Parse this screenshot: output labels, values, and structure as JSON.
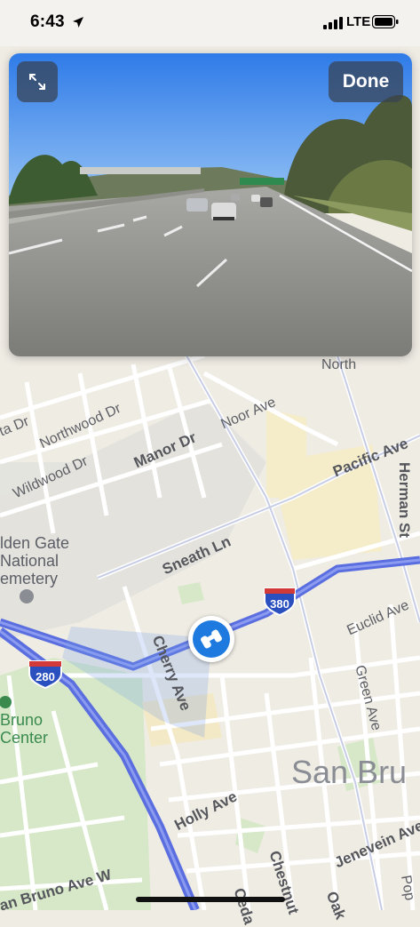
{
  "status_bar": {
    "time": "6:43",
    "carrier": "LTE"
  },
  "look_around": {
    "done_label": "Done"
  },
  "map": {
    "streets": {
      "north": "North",
      "northwood": "Northwood Dr",
      "wildwood": "Wildwood Dr",
      "manor": "Manor Dr",
      "noor": "Noor Ave",
      "pacific": "Pacific Ave",
      "herman": "Herman St",
      "sneath": "Sneath Ln",
      "cherry": "Cherry Ave",
      "euclid": "Euclid Ave",
      "green": "Green Ave",
      "holly": "Holly Ave",
      "jenevein": "Jenevein Ave",
      "chestnut": "Chestnut",
      "san_bruno_w": "an Bruno Ave W",
      "ceda": "Ceda",
      "oak": "Oak",
      "pop": "Pop",
      "ta_dr": "ta Dr"
    },
    "shields": {
      "i380": "380",
      "i280": "280"
    },
    "poi": {
      "cemetery_line1": "lden Gate",
      "cemetery_line2": "National",
      "cemetery_line3": "emetery",
      "center_line1": "Bruno",
      "center_line2": "Center"
    },
    "city": "San Bru"
  },
  "colors": {
    "accent": "#1f7ae0",
    "interstate": "#5a6ee0",
    "park": "#d6e8c8",
    "block": "#f5ecc9"
  }
}
